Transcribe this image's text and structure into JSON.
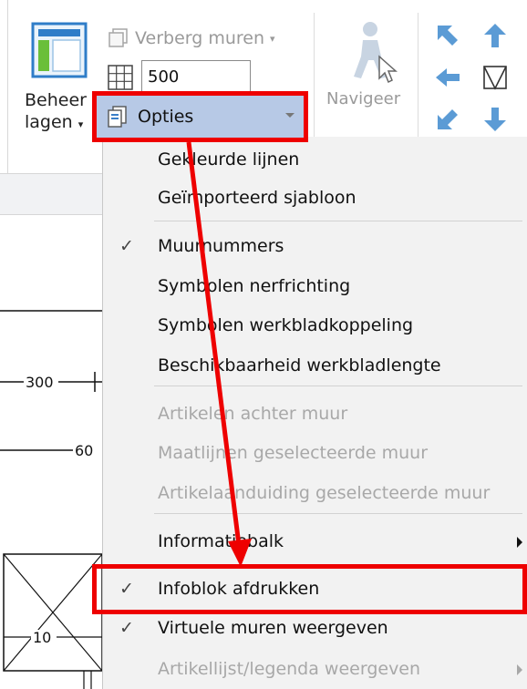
{
  "ribbon": {
    "beheer_line1": "Beheer",
    "beheer_line2": "lagen",
    "verberg_label": "Verberg muren",
    "grid_value": "500",
    "navigeer_label": "Navigeer",
    "opties_label": "Opties"
  },
  "canvas": {
    "dim_300": "300",
    "dim_60": "60",
    "dim_10": "10"
  },
  "menu": {
    "items": [
      {
        "label": "Gekleurde lijnen",
        "checked": false,
        "disabled": false
      },
      {
        "label": "Geïmporteerd sjabloon",
        "checked": false,
        "disabled": false
      },
      {
        "label": "Muurnummers",
        "checked": true,
        "disabled": false
      },
      {
        "label": "Symbolen nerfrichting",
        "checked": false,
        "disabled": false
      },
      {
        "label": "Symbolen werkbladkoppeling",
        "checked": false,
        "disabled": false
      },
      {
        "label": "Beschikbaarheid werkbladlengte",
        "checked": false,
        "disabled": false
      },
      {
        "label": "Artikelen achter muur",
        "checked": false,
        "disabled": true
      },
      {
        "label": "Maatlijnen geselecteerde muur",
        "checked": false,
        "disabled": true
      },
      {
        "label": "Artikelaanduiding geselecteerde muur",
        "checked": false,
        "disabled": true
      },
      {
        "label": "Informatiebalk",
        "checked": false,
        "disabled": false,
        "submenu": true
      },
      {
        "label": "Infoblok afdrukken",
        "checked": true,
        "disabled": false
      },
      {
        "label": "Virtuele muren weergeven",
        "checked": true,
        "disabled": false
      },
      {
        "label": "Artikellijst/legenda weergeven",
        "checked": false,
        "disabled": true,
        "submenu": true
      }
    ],
    "check_glyph": "✓"
  },
  "colors": {
    "annotation": "#ee0000",
    "highlight": "#b7c9e6",
    "menu_bg": "#f2f2f2",
    "disabled_text": "#a8a8a8"
  }
}
